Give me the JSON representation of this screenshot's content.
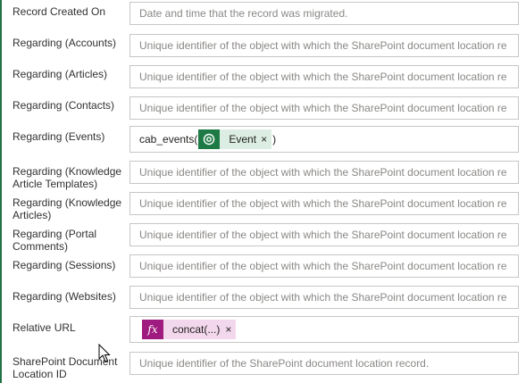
{
  "fields": [
    {
      "label": "Record Created On",
      "placeholder": "Date and time that the record was migrated."
    },
    {
      "label": "Regarding (Accounts)",
      "placeholder": "Unique identifier of the object with which the SharePoint document location re"
    },
    {
      "label": "Regarding (Articles)",
      "placeholder": "Unique identifier of the object with which the SharePoint document location re"
    },
    {
      "label": "Regarding (Contacts)",
      "placeholder": "Unique identifier of the object with which the SharePoint document location re"
    },
    {
      "label": "Regarding (Events)",
      "prefix": "cab_events(",
      "chip": "Event",
      "suffix": ")"
    },
    {
      "label_line1": "Regarding (Knowledge",
      "label_line2": "Article Templates)",
      "placeholder": "Unique identifier of the object with which the SharePoint document location re"
    },
    {
      "label_line1": "Regarding (Knowledge",
      "label_line2": "Articles)",
      "placeholder": "Unique identifier of the object with which the SharePoint document location re"
    },
    {
      "label_line1": "Regarding (Portal",
      "label_line2": "Comments)",
      "placeholder": "Unique identifier of the object with which the SharePoint document location re"
    },
    {
      "label": "Regarding (Sessions)",
      "placeholder": "Unique identifier of the object with which the SharePoint document location re"
    },
    {
      "label": "Regarding (Websites)",
      "placeholder": "Unique identifier of the object with which the SharePoint document location re"
    },
    {
      "label": "Relative URL",
      "chip_icon": "fx",
      "chip": "concat(...)"
    },
    {
      "label_line1": "SharePoint Document",
      "label_line2": "Location ID",
      "placeholder": "Unique identifier of the SharePoint document location record."
    }
  ],
  "icons": {
    "event_chip_icon": "dataverse-icon",
    "formula_chip_icon": "fx-icon",
    "remove": "×"
  },
  "colors": {
    "accent": "#217346",
    "event_chip_bg": "#dcede3",
    "event_icon_bg": "#1e7a45",
    "formula_chip_bg": "#f3d7ec",
    "formula_icon_bg": "#9f1b7f"
  }
}
